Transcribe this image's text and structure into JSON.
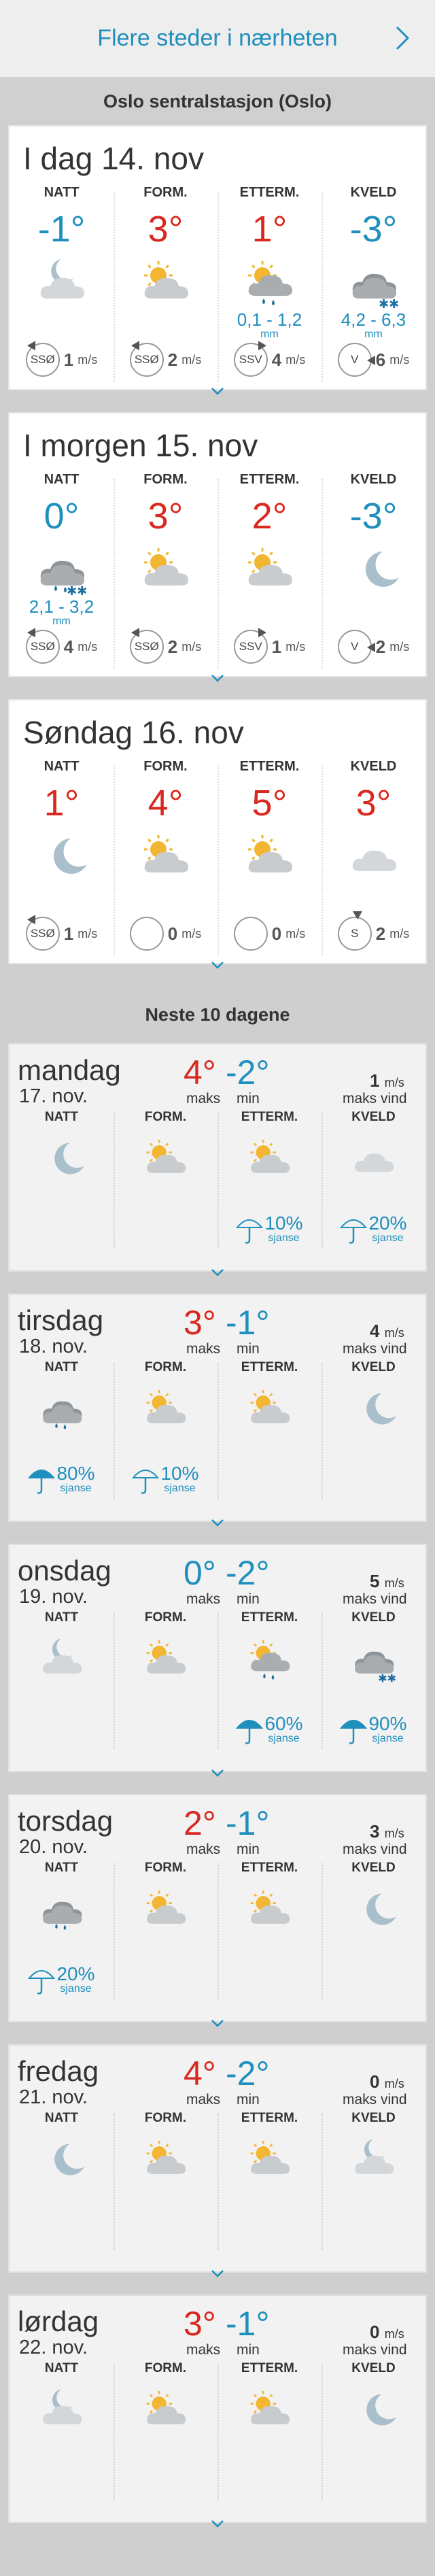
{
  "topbar": {
    "link": "Flere steder i nærheten"
  },
  "location": "Oslo sentralstasjon (Oslo)",
  "days": [
    {
      "title": "I dag 14. nov",
      "periods": [
        {
          "name": "NATT",
          "temp": "-1°",
          "sign": "neg",
          "icon": "moon-cloud",
          "precip": "",
          "mm": "",
          "dir": "SSØ",
          "arrow": "sso",
          "wind": "1"
        },
        {
          "name": "FORM.",
          "temp": "3°",
          "sign": "pos",
          "icon": "sun-cloud",
          "precip": "",
          "mm": "",
          "dir": "SSØ",
          "arrow": "sso",
          "wind": "2"
        },
        {
          "name": "ETTERM.",
          "temp": "1°",
          "sign": "pos",
          "icon": "sun-cloud-rain",
          "precip": "0,1 - 1,2",
          "mm": "mm",
          "dir": "SSV",
          "arrow": "ssv",
          "wind": "4"
        },
        {
          "name": "KVELD",
          "temp": "-3°",
          "sign": "neg",
          "icon": "cloud-snow",
          "precip": "4,2 - 6,3",
          "mm": "mm",
          "dir": "V",
          "arrow": "v",
          "wind": "6"
        }
      ]
    },
    {
      "title": "I morgen 15. nov",
      "periods": [
        {
          "name": "NATT",
          "temp": "0°",
          "sign": "neg",
          "icon": "cloud-rain-snow",
          "precip": "2,1 - 3,2",
          "mm": "mm",
          "dir": "SSØ",
          "arrow": "sso",
          "wind": "4"
        },
        {
          "name": "FORM.",
          "temp": "3°",
          "sign": "pos",
          "icon": "sun-cloud",
          "precip": "",
          "mm": "",
          "dir": "SSØ",
          "arrow": "sso",
          "wind": "2"
        },
        {
          "name": "ETTERM.",
          "temp": "2°",
          "sign": "pos",
          "icon": "sun-cloud",
          "precip": "",
          "mm": "",
          "dir": "SSV",
          "arrow": "ssv",
          "wind": "1"
        },
        {
          "name": "KVELD",
          "temp": "-3°",
          "sign": "neg",
          "icon": "moon",
          "precip": "",
          "mm": "",
          "dir": "V",
          "arrow": "v",
          "wind": "2"
        }
      ]
    },
    {
      "title": "Søndag 16. nov",
      "periods": [
        {
          "name": "NATT",
          "temp": "1°",
          "sign": "pos",
          "icon": "moon",
          "precip": "",
          "mm": "",
          "dir": "SSØ",
          "arrow": "sso",
          "wind": "1"
        },
        {
          "name": "FORM.",
          "temp": "4°",
          "sign": "pos",
          "icon": "sun-cloud",
          "precip": "",
          "mm": "",
          "dir": "",
          "arrow": "",
          "wind": "0"
        },
        {
          "name": "ETTERM.",
          "temp": "5°",
          "sign": "pos",
          "icon": "sun-cloud",
          "precip": "",
          "mm": "",
          "dir": "",
          "arrow": "",
          "wind": "0"
        },
        {
          "name": "KVELD",
          "temp": "3°",
          "sign": "pos",
          "icon": "cloud",
          "precip": "",
          "mm": "",
          "dir": "S",
          "arrow": "s",
          "wind": "2"
        }
      ]
    }
  ],
  "wind_unit": "m/s",
  "section_10": "Neste 10 dagene",
  "labels": {
    "maks": "maks",
    "min": "min",
    "maks_vind": "maks vind",
    "sjanse": "sjanse"
  },
  "long": [
    {
      "day": "mandag",
      "date": "17. nov.",
      "max": "4°",
      "maxsign": "pos",
      "min": "-2°",
      "minsign": "neg",
      "wind": "1",
      "periods": [
        {
          "name": "NATT",
          "icon": "moon",
          "chance": "",
          "umb": ""
        },
        {
          "name": "FORM.",
          "icon": "sun-cloud",
          "chance": "",
          "umb": ""
        },
        {
          "name": "ETTERM.",
          "icon": "sun-cloud",
          "chance": "10%",
          "umb": "open"
        },
        {
          "name": "KVELD",
          "icon": "cloud",
          "chance": "20%",
          "umb": "open"
        }
      ]
    },
    {
      "day": "tirsdag",
      "date": "18. nov.",
      "max": "3°",
      "maxsign": "pos",
      "min": "-1°",
      "minsign": "neg",
      "wind": "4",
      "periods": [
        {
          "name": "NATT",
          "icon": "cloud-rain",
          "chance": "80%",
          "umb": "filled"
        },
        {
          "name": "FORM.",
          "icon": "sun-cloud",
          "chance": "10%",
          "umb": "open"
        },
        {
          "name": "ETTERM.",
          "icon": "sun-cloud",
          "chance": "",
          "umb": ""
        },
        {
          "name": "KVELD",
          "icon": "moon",
          "chance": "",
          "umb": ""
        }
      ]
    },
    {
      "day": "onsdag",
      "date": "19. nov.",
      "max": "0°",
      "maxsign": "neg",
      "min": "-2°",
      "minsign": "neg",
      "wind": "5",
      "periods": [
        {
          "name": "NATT",
          "icon": "moon-cloud",
          "chance": "",
          "umb": ""
        },
        {
          "name": "FORM.",
          "icon": "sun-cloud",
          "chance": "",
          "umb": ""
        },
        {
          "name": "ETTERM.",
          "icon": "sun-cloud-rain",
          "chance": "60%",
          "umb": "filled"
        },
        {
          "name": "KVELD",
          "icon": "cloud-snow",
          "chance": "90%",
          "umb": "filled"
        }
      ]
    },
    {
      "day": "torsdag",
      "date": "20. nov.",
      "max": "2°",
      "maxsign": "pos",
      "min": "-1°",
      "minsign": "neg",
      "wind": "3",
      "periods": [
        {
          "name": "NATT",
          "icon": "cloud-rain",
          "chance": "20%",
          "umb": "open"
        },
        {
          "name": "FORM.",
          "icon": "sun-cloud",
          "chance": "",
          "umb": ""
        },
        {
          "name": "ETTERM.",
          "icon": "sun-cloud",
          "chance": "",
          "umb": ""
        },
        {
          "name": "KVELD",
          "icon": "moon",
          "chance": "",
          "umb": ""
        }
      ]
    },
    {
      "day": "fredag",
      "date": "21. nov.",
      "max": "4°",
      "maxsign": "pos",
      "min": "-2°",
      "minsign": "neg",
      "wind": "0",
      "periods": [
        {
          "name": "NATT",
          "icon": "moon",
          "chance": "",
          "umb": ""
        },
        {
          "name": "FORM.",
          "icon": "sun-cloud",
          "chance": "",
          "umb": ""
        },
        {
          "name": "ETTERM.",
          "icon": "sun-cloud",
          "chance": "",
          "umb": ""
        },
        {
          "name": "KVELD",
          "icon": "moon-cloud",
          "chance": "",
          "umb": ""
        }
      ]
    },
    {
      "day": "lørdag",
      "date": "22. nov.",
      "max": "3°",
      "maxsign": "pos",
      "min": "-1°",
      "minsign": "neg",
      "wind": "0",
      "periods": [
        {
          "name": "NATT",
          "icon": "moon-cloud",
          "chance": "",
          "umb": ""
        },
        {
          "name": "FORM.",
          "icon": "sun-cloud",
          "chance": "",
          "umb": ""
        },
        {
          "name": "ETTERM.",
          "icon": "sun-cloud",
          "chance": "",
          "umb": ""
        },
        {
          "name": "KVELD",
          "icon": "moon",
          "chance": "",
          "umb": ""
        }
      ]
    }
  ]
}
